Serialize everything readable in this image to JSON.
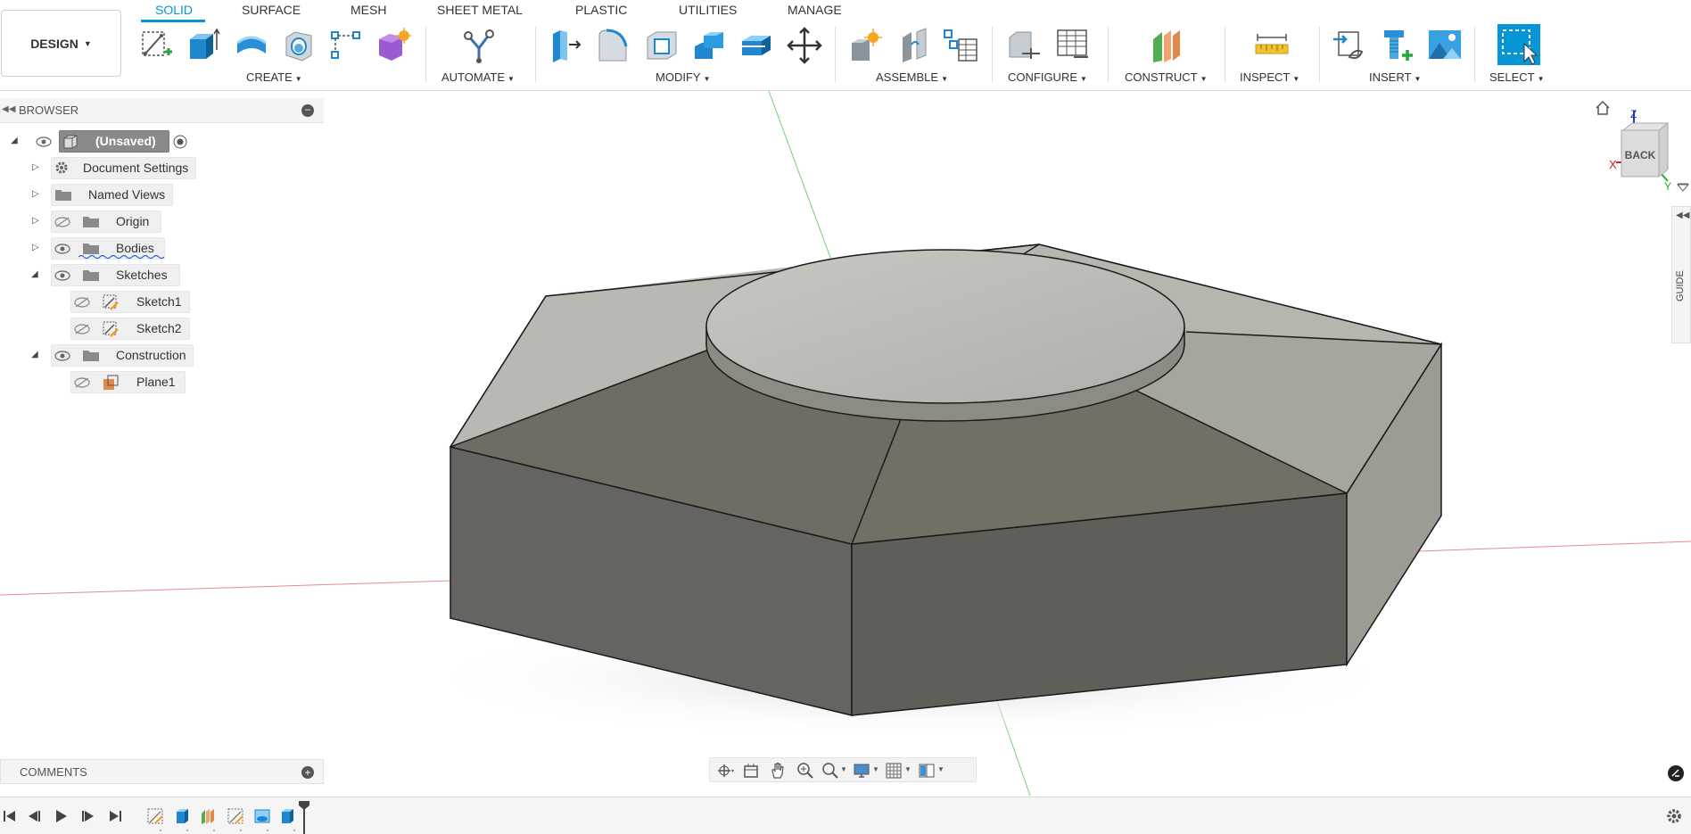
{
  "workspace": {
    "label": "DESIGN"
  },
  "tabs": [
    {
      "label": "SOLID",
      "active": true
    },
    {
      "label": "SURFACE",
      "active": false
    },
    {
      "label": "MESH",
      "active": false
    },
    {
      "label": "SHEET METAL",
      "active": false
    },
    {
      "label": "PLASTIC",
      "active": false
    },
    {
      "label": "UTILITIES",
      "active": false
    },
    {
      "label": "MANAGE",
      "active": false
    }
  ],
  "groups": {
    "create": "CREATE",
    "automate": "AUTOMATE",
    "modify": "MODIFY",
    "assemble": "ASSEMBLE",
    "configure": "CONFIGURE",
    "construct": "CONSTRUCT",
    "inspect": "INSPECT",
    "insert": "INSERT",
    "select": "SELECT"
  },
  "browser": {
    "title": "BROWSER",
    "root": "(Unsaved)",
    "items": [
      {
        "label": "Document Settings",
        "icon": "gear-icon"
      },
      {
        "label": "Named Views",
        "icon": "folder-icon"
      },
      {
        "label": "Origin",
        "icon": "folder-icon"
      },
      {
        "label": "Bodies",
        "icon": "folder-icon"
      },
      {
        "label": "Sketches",
        "icon": "folder-icon"
      },
      {
        "label": "Sketch1",
        "icon": "sketch-icon"
      },
      {
        "label": "Sketch2",
        "icon": "sketch-icon"
      },
      {
        "label": "Construction",
        "icon": "folder-icon"
      },
      {
        "label": "Plane1",
        "icon": "plane-icon"
      }
    ]
  },
  "comments": {
    "title": "COMMENTS"
  },
  "viewcube": {
    "face": "BACK",
    "axis_x": "X",
    "axis_y": "Y",
    "axis_z": "Z"
  },
  "guide": {
    "label": "GUIDE"
  },
  "colors": {
    "accent": "#0696d7",
    "body_top": "#b3b2ab",
    "body_side": "#65645d",
    "x_axis": "#e05050",
    "y_axis": "#50c050"
  }
}
